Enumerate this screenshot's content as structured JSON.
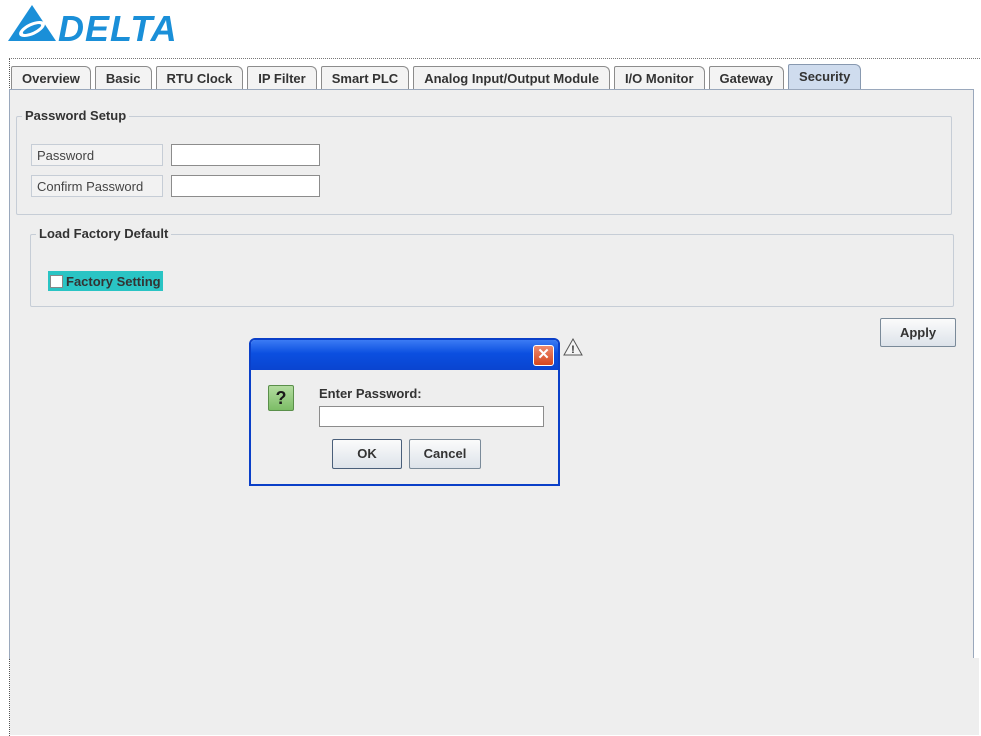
{
  "brand": {
    "logo_text": "DELTA",
    "color": "#1a8fd8"
  },
  "tabs": [
    {
      "label": "Overview",
      "selected": false
    },
    {
      "label": "Basic",
      "selected": false
    },
    {
      "label": "RTU Clock",
      "selected": false
    },
    {
      "label": "IP Filter",
      "selected": false
    },
    {
      "label": "Smart PLC",
      "selected": false
    },
    {
      "label": "Analog Input/Output Module",
      "selected": false
    },
    {
      "label": "I/O Monitor",
      "selected": false
    },
    {
      "label": "Gateway",
      "selected": false
    },
    {
      "label": "Security",
      "selected": true
    }
  ],
  "password_setup": {
    "title": "Password Setup",
    "password_label": "Password",
    "password_value": "",
    "confirm_label": "Confirm Password",
    "confirm_value": ""
  },
  "factory_default": {
    "title": "Load Factory Default",
    "checkbox_label": "Factory Setting",
    "checked": false,
    "highlight_color": "#2ac4c4"
  },
  "apply_label": "Apply",
  "dialog": {
    "title": "",
    "prompt": "Enter Password:",
    "input_value": "",
    "ok_label": "OK",
    "cancel_label": "Cancel",
    "close_glyph": "✕",
    "question_glyph": "?",
    "titlebar_color": "#0b4fe0"
  },
  "warning_glyph": "!"
}
